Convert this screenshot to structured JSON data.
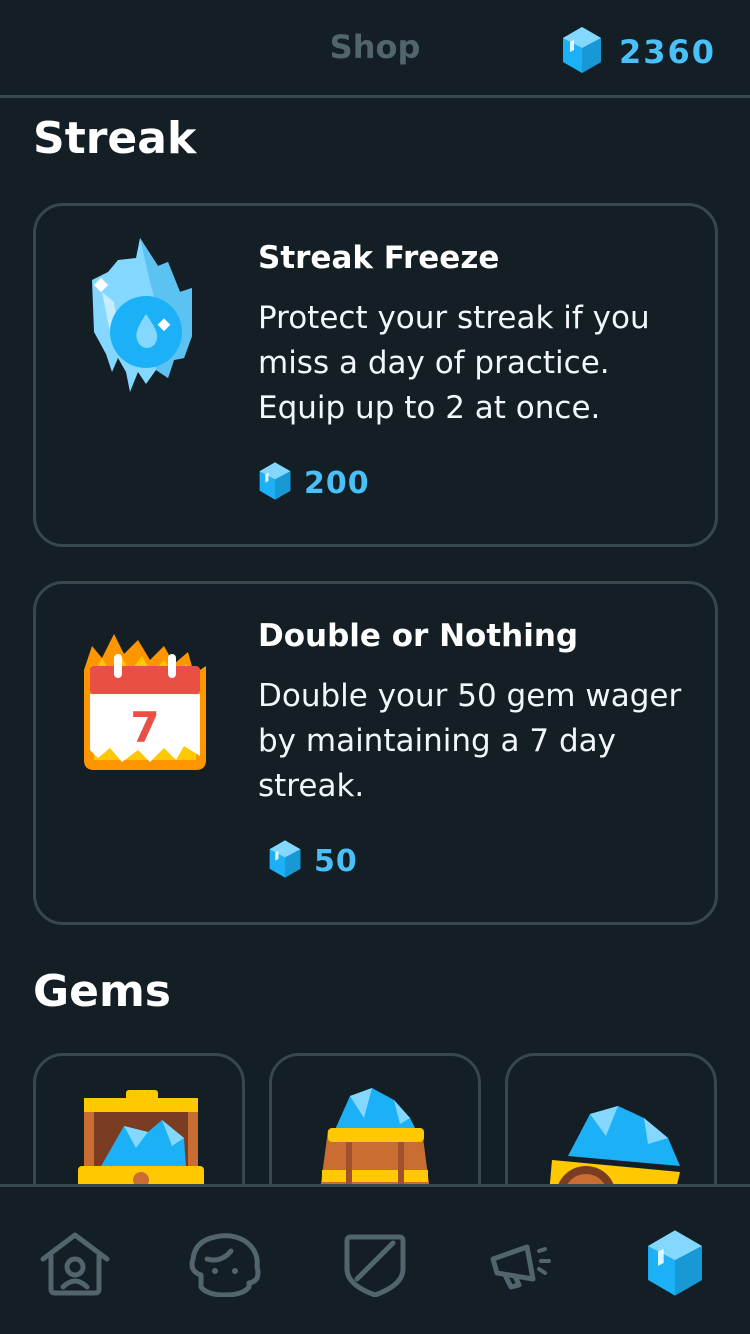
{
  "header": {
    "title": "Shop",
    "gem_count": "2360",
    "gem_icon": "gem-icon"
  },
  "streak_section": {
    "title": "Streak",
    "items": [
      {
        "title": "Streak Freeze",
        "description": "Protect your streak if you miss a day of practice. Equip up to 2 at once.",
        "price": "200",
        "icon": "ice-crystal-icon"
      },
      {
        "title": "Double or Nothing",
        "description": "Double your 50 gem wager by maintaining a 7 day streak.",
        "price": "50",
        "icon": "burning-calendar-icon",
        "calendar_day": "7"
      }
    ]
  },
  "gems_section": {
    "title": "Gems",
    "packs": [
      {
        "icon": "treasure-chest-icon"
      },
      {
        "icon": "gem-barrel-icon"
      },
      {
        "icon": "gem-cart-icon"
      }
    ]
  },
  "tabbar": {
    "tabs": [
      {
        "name": "home",
        "icon": "home-icon",
        "active": false
      },
      {
        "name": "profile",
        "icon": "profile-icon",
        "active": false
      },
      {
        "name": "leagues",
        "icon": "shield-icon",
        "active": false
      },
      {
        "name": "news",
        "icon": "megaphone-icon",
        "active": false
      },
      {
        "name": "shop",
        "icon": "gem-icon",
        "active": true
      }
    ]
  },
  "colors": {
    "background": "#131f24",
    "border": "#37464f",
    "gem_blue": "#49c0f8",
    "muted_text": "#52656d"
  }
}
